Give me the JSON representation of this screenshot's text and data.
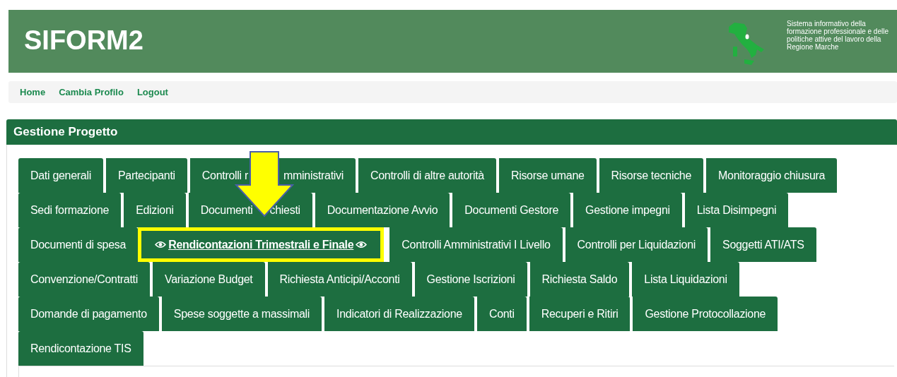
{
  "header": {
    "title": "SIFORM2",
    "tagline": "Sistema informativo della formazione professionale e delle politiche attive del lavoro della Regione Marche"
  },
  "nav": [
    {
      "label": "Home"
    },
    {
      "label": "Cambia Profilo"
    },
    {
      "label": "Logout"
    }
  ],
  "panel": {
    "title": "Gestione Progetto",
    "tab_rows": [
      [
        {
          "label": "Dati generali",
          "selected": false
        },
        {
          "label": "Partecipanti",
          "selected": false
        },
        {
          "label_parts": [
            "Controlli r",
            "mministrativi"
          ],
          "selected": false
        },
        {
          "label": "Controlli di altre autorità",
          "selected": false
        },
        {
          "label": "Risorse umane",
          "selected": false
        },
        {
          "label": "Risorse tecniche",
          "selected": false
        },
        {
          "label": "Monitoraggio chiusura",
          "selected": false
        }
      ],
      [
        {
          "label": "Sedi formazione",
          "selected": false
        },
        {
          "label": "Edizioni",
          "selected": false
        },
        {
          "label_parts": [
            "Documenti",
            "chiesti"
          ],
          "selected": false
        },
        {
          "label": "Documentazione Avvio",
          "selected": false
        },
        {
          "label": "Documenti Gestore",
          "selected": false
        },
        {
          "label": "Gestione impegni",
          "selected": false
        },
        {
          "label": "Lista Disimpegni",
          "selected": false
        }
      ],
      [
        {
          "label": "Documenti di spesa",
          "selected": false
        },
        {
          "label": "Rendicontazioni Trimestrali e Finale",
          "selected": true,
          "highlighted": true
        },
        {
          "label": "Controlli Amministrativi I Livello",
          "selected": false
        },
        {
          "label": "Controlli per Liquidazioni",
          "selected": false
        },
        {
          "label": "Soggetti ATI/ATS",
          "selected": false
        }
      ],
      [
        {
          "label": "Convenzione/Contratti",
          "selected": false
        },
        {
          "label": "Variazione Budget",
          "selected": false
        },
        {
          "label": "Richiesta Anticipi/Acconti",
          "selected": false
        },
        {
          "label": "Gestione Iscrizioni",
          "selected": false
        },
        {
          "label": "Richiesta Saldo",
          "selected": false
        },
        {
          "label": "Lista Liquidazioni",
          "selected": false
        }
      ],
      [
        {
          "label": "Domande di pagamento",
          "selected": false
        },
        {
          "label": "Spese soggette a massimali",
          "selected": false
        },
        {
          "label": "Indicatori di Realizzazione",
          "selected": false
        },
        {
          "label": "Conti",
          "selected": false
        },
        {
          "label": "Recuperi e Ritiri",
          "selected": false
        },
        {
          "label": "Gestione Protocollazione",
          "selected": false
        }
      ],
      [
        {
          "label": "Rendicontazione TIS",
          "selected": false
        }
      ]
    ]
  }
}
